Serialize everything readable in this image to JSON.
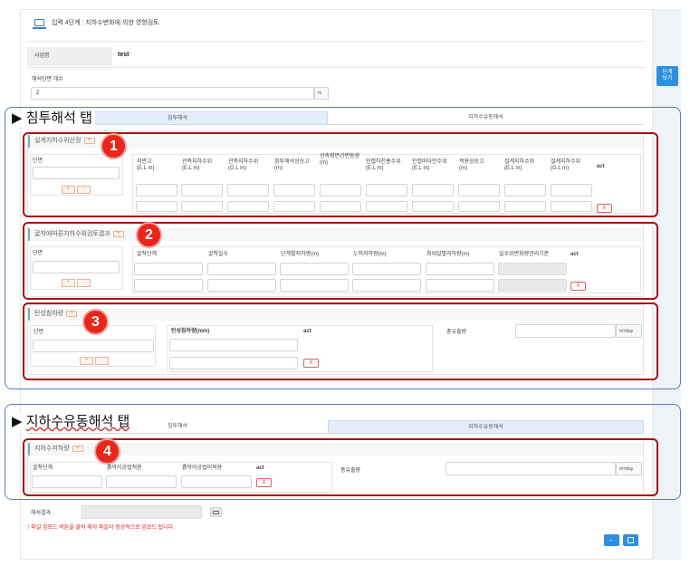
{
  "header": {
    "title": "입력 4단계 : 지하수변화에 의한 영향검토."
  },
  "project": {
    "label": "사업명",
    "value": "test"
  },
  "sections_count": {
    "label": "해석단면 개수",
    "value": "2",
    "unit": "m"
  },
  "right_panel": {
    "button": "단계\n보기"
  },
  "annotations": {
    "top": "침투해석 탭",
    "bottom": "지하수유동해석 탭",
    "badges": [
      "1",
      "2",
      "3",
      "4"
    ]
  },
  "tabs": {
    "tab1": "침투해석",
    "tab2": "지하수유동해석"
  },
  "s1": {
    "title": "설계지하수위산정",
    "section_label": "단면",
    "headers": [
      "지반고\n(E.L m)",
      "관측지하수위\n(E.L m)",
      "관측지하수위\n(G.L m)",
      "침투해석상승고\n(m)",
      "관측평면간변동량\n(m)",
      "인접하천홍수위\n(E.L m)",
      "인접바다만수위\n(E.L m)",
      "적용상승고\n(m)",
      "설계지하수위\n(E.L m)",
      "설계지하수위\n(G.L m)",
      "act"
    ]
  },
  "s2": {
    "title": "굴착에따른지하수위검토결과",
    "section_label": "단면",
    "headers": [
      "굴착단계",
      "굴착일수",
      "단계별저하량(m)",
      "누적저하량(m)",
      "최대일별저하량(m)",
      "일수위변화량관리기준",
      "act"
    ]
  },
  "s3": {
    "title": "탄성침하량",
    "section_label": "단면",
    "headers": [
      "탄성침하량(mm)",
      "act"
    ],
    "flow_label": "총유출량",
    "flow_unit": "m³/day"
  },
  "s4": {
    "title": "지하수저하량",
    "headers": [
      "굴착단계",
      "흙막이공법적용",
      "흙막이공법미적용",
      "act"
    ],
    "flow_label": "총유출량",
    "flow_unit": "m³/day"
  },
  "buttons": {
    "plus": "+",
    "minus": "-",
    "x": "X",
    "add": "+"
  },
  "result": {
    "label": "해석결과",
    "note": "! 파일 업로드 버튼을 클릭 해야 파일이 정상적으로 업로드 됩니다."
  },
  "colors": {
    "annotation_red": "#a51212",
    "annotation_blue": "#5a7fc1",
    "badge": "#e8261c",
    "primary": "#2d8fe0"
  }
}
